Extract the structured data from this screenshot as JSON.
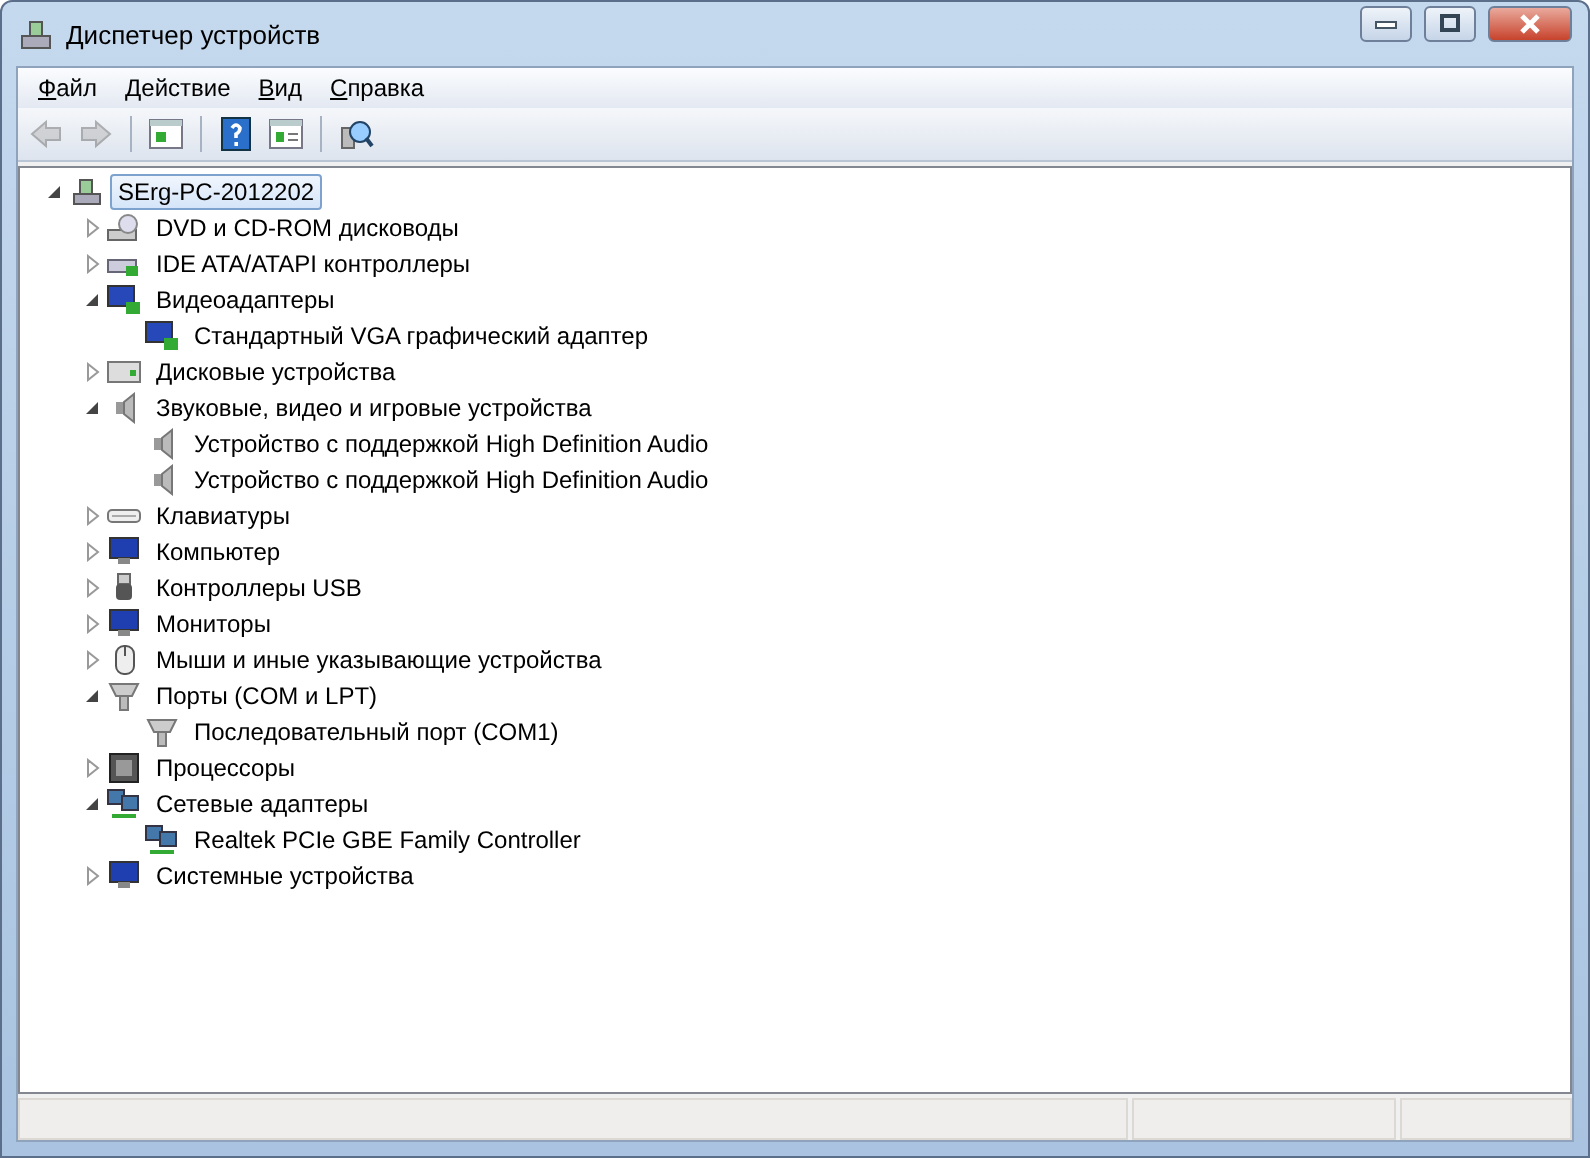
{
  "window": {
    "title": "Диспетчер устройств"
  },
  "menu": [
    {
      "label": "Файл"
    },
    {
      "label": "Действие"
    },
    {
      "label": "Вид"
    },
    {
      "label": "Справка"
    }
  ],
  "toolbar": [
    {
      "kind": "back",
      "disabled": true
    },
    {
      "kind": "forward",
      "disabled": true
    },
    {
      "kind": "separator"
    },
    {
      "kind": "tree",
      "disabled": false
    },
    {
      "kind": "separator"
    },
    {
      "kind": "help",
      "disabled": false
    },
    {
      "kind": "properties",
      "disabled": false
    },
    {
      "kind": "separator"
    },
    {
      "kind": "scan",
      "disabled": false
    }
  ],
  "tree": {
    "label": "SErg-PC-2012202",
    "kind": "computer",
    "expanded": true,
    "selected": true,
    "children": [
      {
        "label": "DVD и CD-ROM дисководы",
        "kind": "dvd",
        "expanded": false,
        "selected": false
      },
      {
        "label": "IDE ATA/ATAPI контроллеры",
        "kind": "ide",
        "expanded": false,
        "selected": false
      },
      {
        "label": "Видеоадаптеры",
        "kind": "display",
        "expanded": true,
        "selected": false,
        "children": [
          {
            "label": "Стандартный VGA графический адаптер",
            "kind": "display",
            "selected": false
          }
        ]
      },
      {
        "label": "Дисковые устройства",
        "kind": "disk",
        "expanded": false,
        "selected": false
      },
      {
        "label": "Звуковые, видео и игровые устройства",
        "kind": "sound",
        "expanded": true,
        "selected": false,
        "children": [
          {
            "label": "Устройство с поддержкой High Definition Audio",
            "kind": "sound",
            "selected": false
          },
          {
            "label": "Устройство с поддержкой High Definition Audio",
            "kind": "sound",
            "selected": false
          }
        ]
      },
      {
        "label": "Клавиатуры",
        "kind": "keyboard",
        "expanded": false,
        "selected": false
      },
      {
        "label": "Компьютер",
        "kind": "monitor",
        "expanded": false,
        "selected": false
      },
      {
        "label": "Контроллеры USB",
        "kind": "usb",
        "expanded": false,
        "selected": false
      },
      {
        "label": "Мониторы",
        "kind": "monitor",
        "expanded": false,
        "selected": false
      },
      {
        "label": "Мыши и иные указывающие устройства",
        "kind": "mouse",
        "expanded": false,
        "selected": false
      },
      {
        "label": "Порты (COM и LPT)",
        "kind": "port",
        "expanded": true,
        "selected": false,
        "children": [
          {
            "label": "Последовательный порт (COM1)",
            "kind": "port",
            "selected": false
          }
        ]
      },
      {
        "label": "Процессоры",
        "kind": "cpu",
        "expanded": false,
        "selected": false
      },
      {
        "label": "Сетевые адаптеры",
        "kind": "network",
        "expanded": true,
        "selected": false,
        "children": [
          {
            "label": "Realtek PCIe GBE Family Controller",
            "kind": "network",
            "selected": false
          }
        ]
      },
      {
        "label": "Системные устройства",
        "kind": "monitor",
        "expanded": false,
        "selected": false
      }
    ]
  }
}
